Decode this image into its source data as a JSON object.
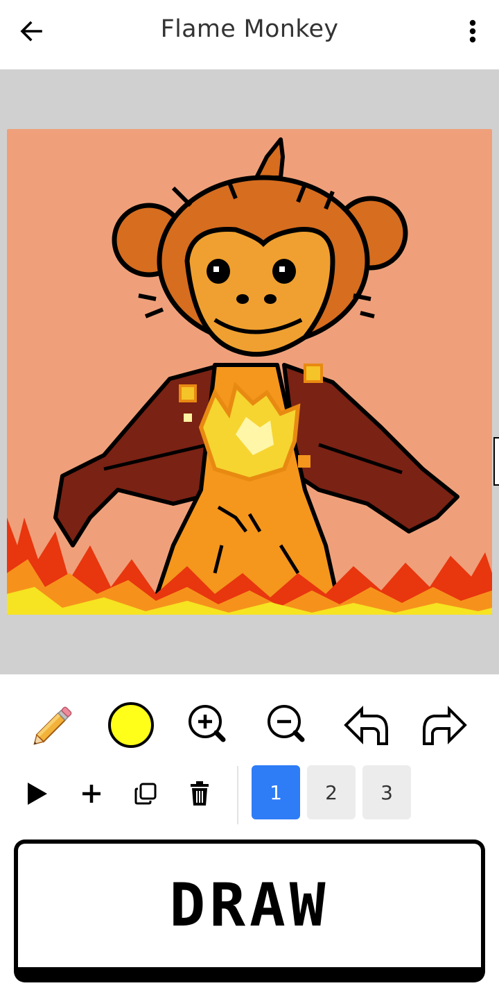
{
  "app_bar": {
    "title": "Flame Monkey",
    "back_icon": "arrow-left-icon",
    "menu_icon": "more-vertical-icon"
  },
  "canvas": {
    "background_color": "#efa07a",
    "frame_color": "#d0d0d0"
  },
  "tools": [
    {
      "name": "pencil-tool",
      "icon": "pencil-icon"
    },
    {
      "name": "color-picker",
      "icon": "color-swatch",
      "current_color": "#ffff19"
    },
    {
      "name": "zoom-in",
      "icon": "zoom-in-icon"
    },
    {
      "name": "zoom-out",
      "icon": "zoom-out-icon"
    },
    {
      "name": "undo",
      "icon": "undo-arrow-icon"
    },
    {
      "name": "redo",
      "icon": "redo-arrow-icon"
    }
  ],
  "frame_actions": [
    {
      "name": "play",
      "icon": "play-icon"
    },
    {
      "name": "add-frame",
      "icon": "plus-icon"
    },
    {
      "name": "duplicate-frame",
      "icon": "copy-icon"
    },
    {
      "name": "delete-frame",
      "icon": "trash-icon"
    }
  ],
  "frames": [
    {
      "label": "1",
      "active": true
    },
    {
      "label": "2",
      "active": false
    },
    {
      "label": "3",
      "active": false
    }
  ],
  "draw_button": {
    "label": "DRAW"
  },
  "colors": {
    "accent": "#2e7cf6",
    "inactive_tab": "#ececec"
  }
}
